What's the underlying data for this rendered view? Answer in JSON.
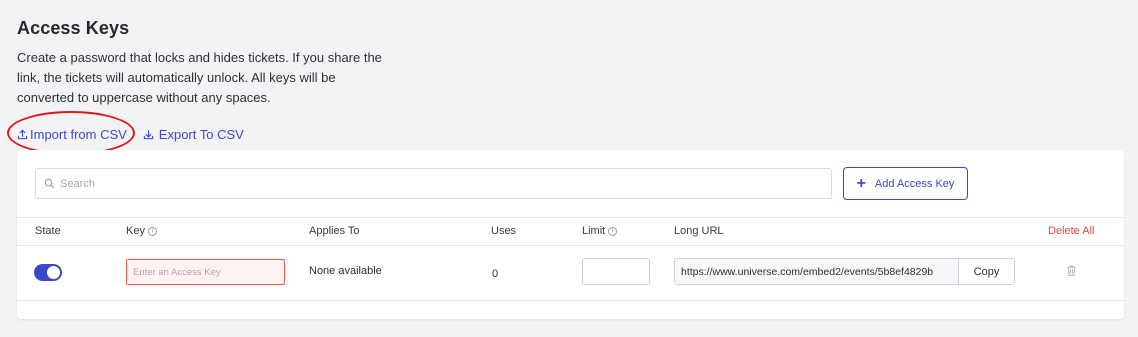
{
  "header": {
    "title": "Access Keys",
    "description": "Create a password that locks and hides tickets. If you share the link, the tickets will automatically unlock. All keys will be converted to uppercase without any spaces."
  },
  "csv": {
    "import_label": "Import from CSV",
    "import_icon": "upload-icon",
    "export_label": "Export To CSV",
    "export_icon": "download-icon"
  },
  "toolbar": {
    "search_placeholder": "Search",
    "search_icon": "search-icon",
    "add_label": "Add Access Key"
  },
  "table": {
    "columns": {
      "state": "State",
      "key": "Key",
      "applies_to": "Applies To",
      "uses": "Uses",
      "limit": "Limit",
      "long_url": "Long URL",
      "delete_all": "Delete All"
    },
    "rows": [
      {
        "state": "on",
        "key_value": "",
        "key_placeholder": "Enter an Access Key",
        "applies_to": "None available",
        "uses": "0",
        "limit": "",
        "long_url": "https://www.universe.com/embed2/events/5b8ef4829b",
        "copy_label": "Copy"
      }
    ]
  },
  "colors": {
    "accent": "#3b49c9",
    "danger": "#e5433f",
    "annotation": "#e01818",
    "background": "#f3f3f5"
  }
}
